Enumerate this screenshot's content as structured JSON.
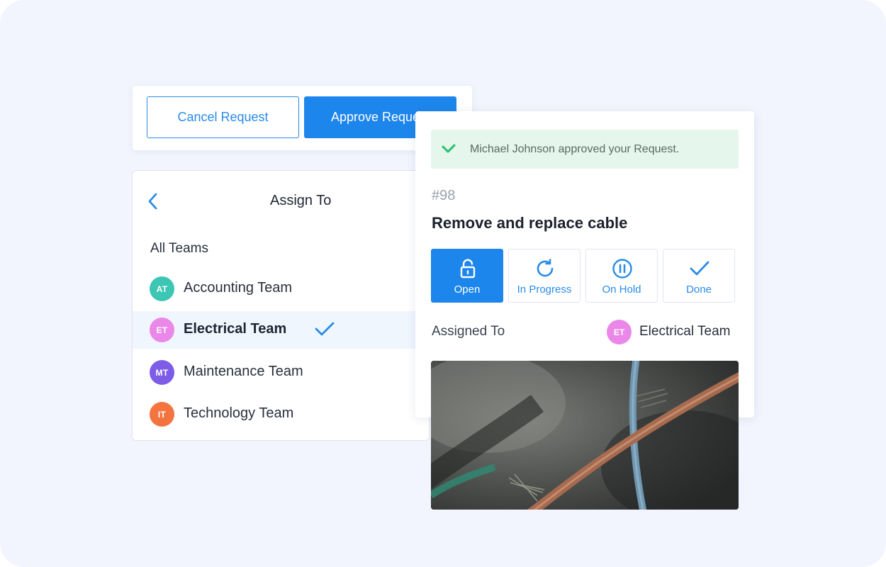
{
  "request_actions": {
    "cancel_label": "Cancel Request",
    "approve_label": "Approve Request"
  },
  "assign": {
    "title": "Assign To",
    "section_label": "All Teams",
    "teams": [
      {
        "initials": "AT",
        "name": "Accounting Team",
        "color": "#3cc6b3",
        "selected": false
      },
      {
        "initials": "ET",
        "name": "Electrical Team",
        "color": "#ea87e8",
        "selected": true
      },
      {
        "initials": "MT",
        "name": "Maintenance Team",
        "color": "#7d5ce8",
        "selected": false
      },
      {
        "initials": "IT",
        "name": "Technology Team",
        "color": "#f4743f",
        "selected": false
      }
    ]
  },
  "work_order": {
    "notification": "Michael Johnson approved your Request.",
    "id": "#98",
    "title": "Remove and replace cable",
    "statuses": [
      {
        "label": "Open",
        "icon": "unlock-icon",
        "active": true
      },
      {
        "label": "In Progress",
        "icon": "refresh-icon",
        "active": false
      },
      {
        "label": "On Hold",
        "icon": "pause-icon",
        "active": false
      },
      {
        "label": "Done",
        "icon": "check-icon",
        "active": false
      }
    ],
    "assigned_label": "Assigned To",
    "assigned_team": "Electrical Team",
    "assigned_initials": "ET"
  },
  "colors": {
    "accent": "#1d86ec",
    "success_bg": "#e5f6ec",
    "success": "#22c26a"
  }
}
